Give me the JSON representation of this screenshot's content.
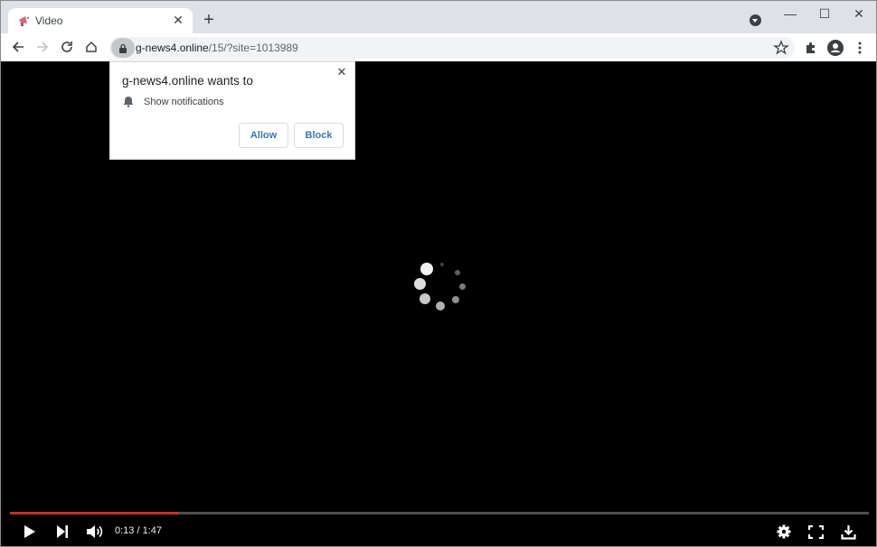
{
  "browser": {
    "tab": {
      "title": "Video",
      "favicon": "megaphone-icon",
      "close_icon": "close-icon"
    },
    "new_tab_icon": "plus-icon",
    "tab_search_icon": "chevron-down-circle-icon",
    "window_controls": {
      "minimize": "—",
      "maximize": "☐",
      "close": "✕"
    },
    "toolbar": {
      "back_icon": "arrow-left-icon",
      "forward_icon": "arrow-right-icon",
      "reload_icon": "reload-icon",
      "home_icon": "home-icon",
      "url_host": "g-news4.online",
      "url_path": "/15/?site=1013989",
      "bookmark_icon": "star-icon",
      "extensions_icon": "puzzle-icon",
      "profile_icon": "account-circle-icon",
      "menu_icon": "kebab-menu-icon"
    }
  },
  "permission_popup": {
    "title": "g-news4.online wants to",
    "permission": "Show notifications",
    "permission_icon": "bell-icon",
    "allow_label": "Allow",
    "block_label": "Block",
    "close_icon": "close-icon"
  },
  "player": {
    "state": "loading",
    "current_time": "0:13",
    "duration": "1:47",
    "time_display": "0:13 / 1:47",
    "progress_fraction": 0.197,
    "accent_color": "#c4302b",
    "controls": [
      "play-icon",
      "next-icon",
      "volume-icon",
      "settings-icon",
      "fullscreen-icon",
      "download-icon"
    ]
  }
}
